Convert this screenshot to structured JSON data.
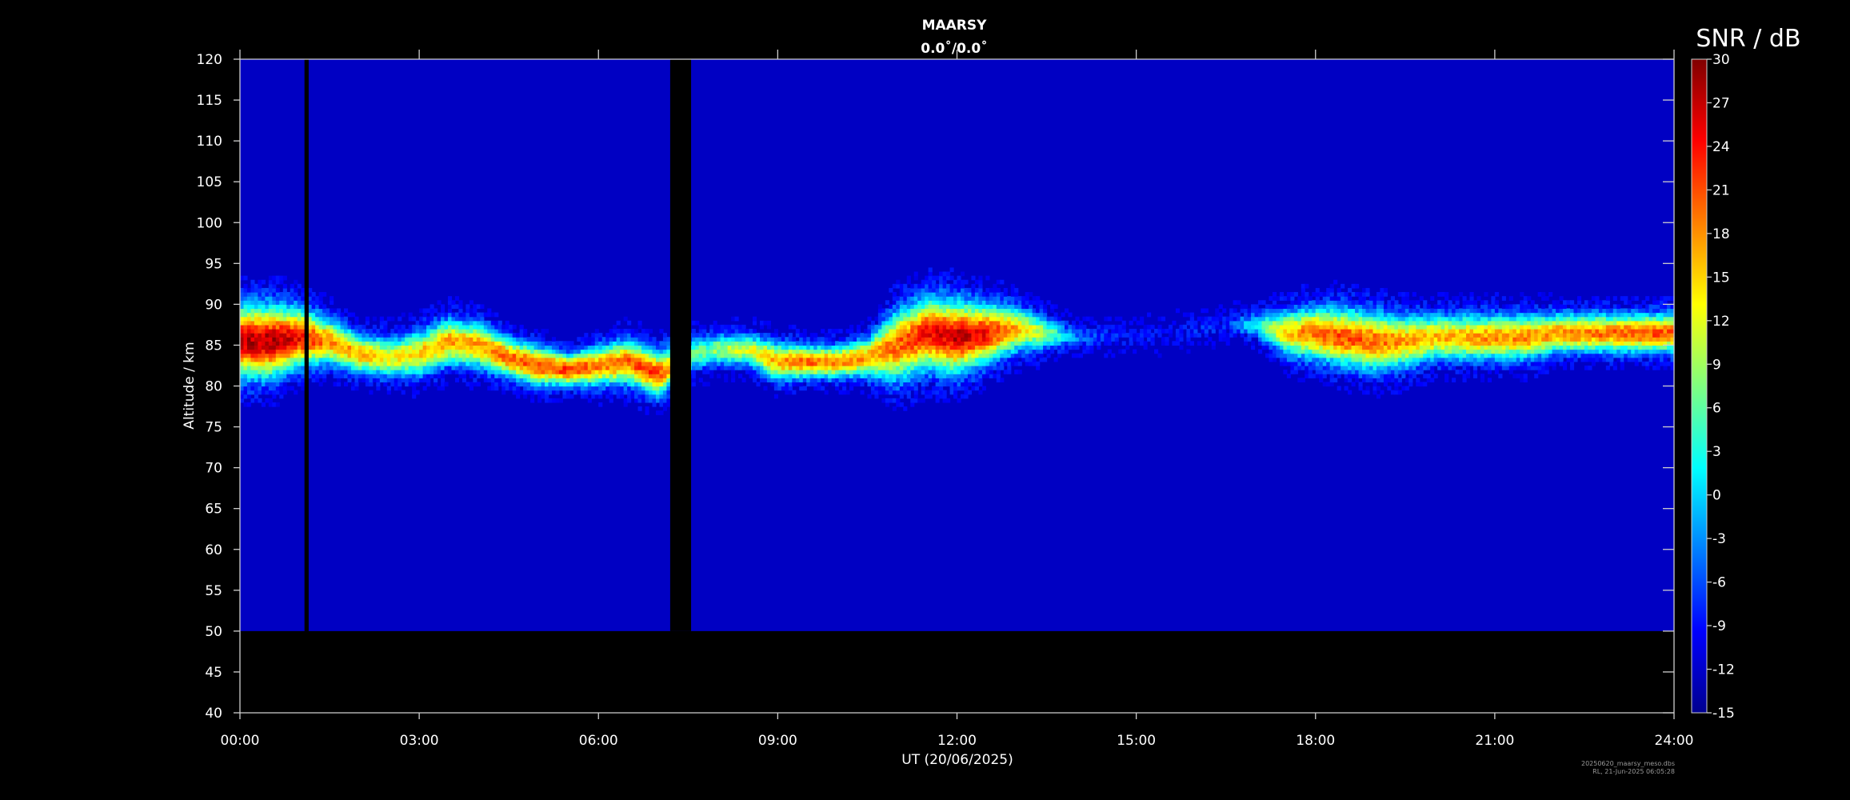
{
  "chart_data": {
    "type": "heatmap",
    "title": "MAARSY",
    "subtitle": "0.0˚/0.0˚",
    "xlabel": "UT (20/06/2025)",
    "ylabel": "Altitude / km",
    "x_ticks": [
      "00:00",
      "03:00",
      "06:00",
      "09:00",
      "12:00",
      "15:00",
      "18:00",
      "21:00",
      "24:00"
    ],
    "xlim_hours": [
      0,
      24
    ],
    "ylim": [
      40,
      120
    ],
    "y_ticks": [
      40,
      45,
      50,
      55,
      60,
      65,
      70,
      75,
      80,
      85,
      90,
      95,
      100,
      105,
      110,
      115,
      120
    ],
    "data_altitude_range": [
      50,
      120
    ],
    "colorbar": {
      "label": "SNR / dB",
      "min": -15,
      "max": 30,
      "ticks": [
        -15,
        -12,
        -9,
        -6,
        -3,
        0,
        3,
        6,
        9,
        12,
        15,
        18,
        21,
        24,
        27,
        30
      ],
      "colormap": "jet"
    },
    "background_snr_db": -12,
    "data_gaps_hours": [
      [
        1.08,
        1.15
      ],
      [
        7.2,
        7.55
      ]
    ],
    "echo_layer": [
      {
        "t": 0.0,
        "center": 85.5,
        "thickness": 5,
        "peak": 27
      },
      {
        "t": 0.5,
        "center": 85.5,
        "thickness": 5,
        "peak": 28
      },
      {
        "t": 1.0,
        "center": 86,
        "thickness": 4,
        "peak": 25
      },
      {
        "t": 1.5,
        "center": 85.5,
        "thickness": 3,
        "peak": 18
      },
      {
        "t": 2.0,
        "center": 84,
        "thickness": 2.5,
        "peak": 17
      },
      {
        "t": 2.5,
        "center": 83.5,
        "thickness": 2.5,
        "peak": 13
      },
      {
        "t": 3.0,
        "center": 84,
        "thickness": 3,
        "peak": 15
      },
      {
        "t": 3.5,
        "center": 85.5,
        "thickness": 3,
        "peak": 18
      },
      {
        "t": 4.0,
        "center": 85,
        "thickness": 3,
        "peak": 17
      },
      {
        "t": 4.5,
        "center": 83.5,
        "thickness": 2.5,
        "peak": 20
      },
      {
        "t": 5.0,
        "center": 82.5,
        "thickness": 2.5,
        "peak": 21
      },
      {
        "t": 5.5,
        "center": 82,
        "thickness": 2,
        "peak": 22
      },
      {
        "t": 6.0,
        "center": 82.5,
        "thickness": 2.5,
        "peak": 19
      },
      {
        "t": 6.5,
        "center": 83,
        "thickness": 3,
        "peak": 20
      },
      {
        "t": 7.0,
        "center": 81.5,
        "thickness": 3,
        "peak": 22
      },
      {
        "t": 7.6,
        "center": 84,
        "thickness": 2,
        "peak": 6
      },
      {
        "t": 8.0,
        "center": 84.5,
        "thickness": 2,
        "peak": 8
      },
      {
        "t": 8.5,
        "center": 84.5,
        "thickness": 2,
        "peak": 12
      },
      {
        "t": 9.0,
        "center": 83,
        "thickness": 2.5,
        "peak": 17
      },
      {
        "t": 9.5,
        "center": 83,
        "thickness": 2,
        "peak": 20
      },
      {
        "t": 10.0,
        "center": 83,
        "thickness": 2,
        "peak": 19
      },
      {
        "t": 10.5,
        "center": 83.5,
        "thickness": 2.5,
        "peak": 17
      },
      {
        "t": 11.0,
        "center": 85,
        "thickness": 5,
        "peak": 20
      },
      {
        "t": 11.5,
        "center": 86.5,
        "thickness": 5,
        "peak": 24
      },
      {
        "t": 12.0,
        "center": 86,
        "thickness": 5,
        "peak": 27
      },
      {
        "t": 12.5,
        "center": 86.5,
        "thickness": 4,
        "peak": 24
      },
      {
        "t": 13.0,
        "center": 87,
        "thickness": 3,
        "peak": 16
      },
      {
        "t": 13.5,
        "center": 86.5,
        "thickness": 2,
        "peak": 8
      },
      {
        "t": 14.0,
        "center": 86,
        "thickness": 1,
        "peak": -4
      },
      {
        "t": 15.0,
        "center": 86,
        "thickness": 1,
        "peak": -10
      },
      {
        "t": 16.5,
        "center": 87.5,
        "thickness": 1,
        "peak": -8
      },
      {
        "t": 17.0,
        "center": 87.5,
        "thickness": 1.5,
        "peak": 2
      },
      {
        "t": 17.5,
        "center": 86.5,
        "thickness": 3,
        "peak": 15
      },
      {
        "t": 18.0,
        "center": 86.5,
        "thickness": 3.5,
        "peak": 20
      },
      {
        "t": 18.5,
        "center": 86,
        "thickness": 4,
        "peak": 21
      },
      {
        "t": 19.0,
        "center": 85.5,
        "thickness": 4,
        "peak": 20
      },
      {
        "t": 19.5,
        "center": 85.5,
        "thickness": 3.5,
        "peak": 17
      },
      {
        "t": 20.0,
        "center": 86,
        "thickness": 3,
        "peak": 16
      },
      {
        "t": 20.5,
        "center": 86,
        "thickness": 3,
        "peak": 17
      },
      {
        "t": 21.0,
        "center": 86,
        "thickness": 3,
        "peak": 18
      },
      {
        "t": 21.5,
        "center": 86,
        "thickness": 3,
        "peak": 18
      },
      {
        "t": 22.0,
        "center": 86.5,
        "thickness": 2.5,
        "peak": 18
      },
      {
        "t": 22.5,
        "center": 86.5,
        "thickness": 2.5,
        "peak": 19
      },
      {
        "t": 23.0,
        "center": 86.5,
        "thickness": 2.5,
        "peak": 20
      },
      {
        "t": 23.5,
        "center": 86.5,
        "thickness": 2.5,
        "peak": 21
      },
      {
        "t": 24.0,
        "center": 86.5,
        "thickness": 2.5,
        "peak": 20
      }
    ]
  },
  "footer": {
    "line1": "20250620_maarsy_meso.dbs",
    "line2": "RL, 21-Jun-2025 06:05:28"
  }
}
